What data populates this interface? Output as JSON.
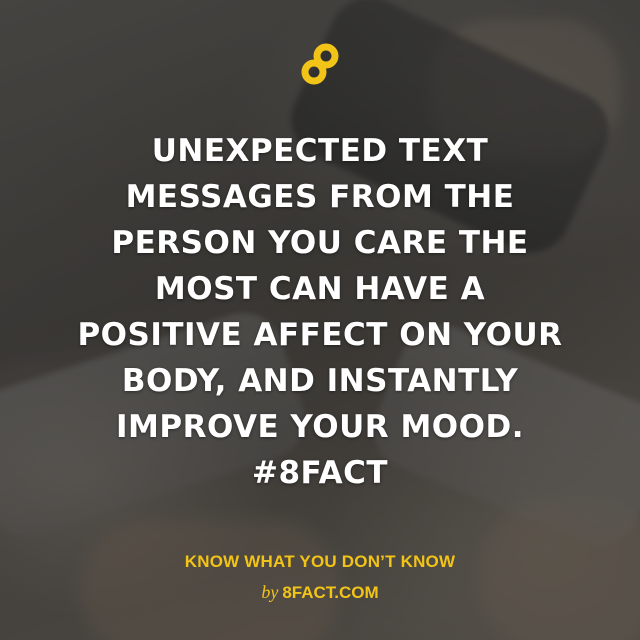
{
  "colors": {
    "accent": "#f2c418",
    "text": "#ffffff"
  },
  "logo": {
    "icon": "infinity-eight-icon"
  },
  "fact": {
    "lines": [
      "UNEXPECTED TEXT",
      "MESSAGES FROM THE",
      "PERSON YOU CARE THE",
      "MOST CAN HAVE A",
      "POSITIVE AFFECT ON YOUR",
      "BODY, AND INSTANTLY",
      "IMPROVE YOUR MOOD.",
      "#8FACT"
    ]
  },
  "footer": {
    "tagline": "KNOW WHAT YOU DON’T KNOW",
    "by_prefix": "by",
    "site": "8FACT.COM"
  }
}
